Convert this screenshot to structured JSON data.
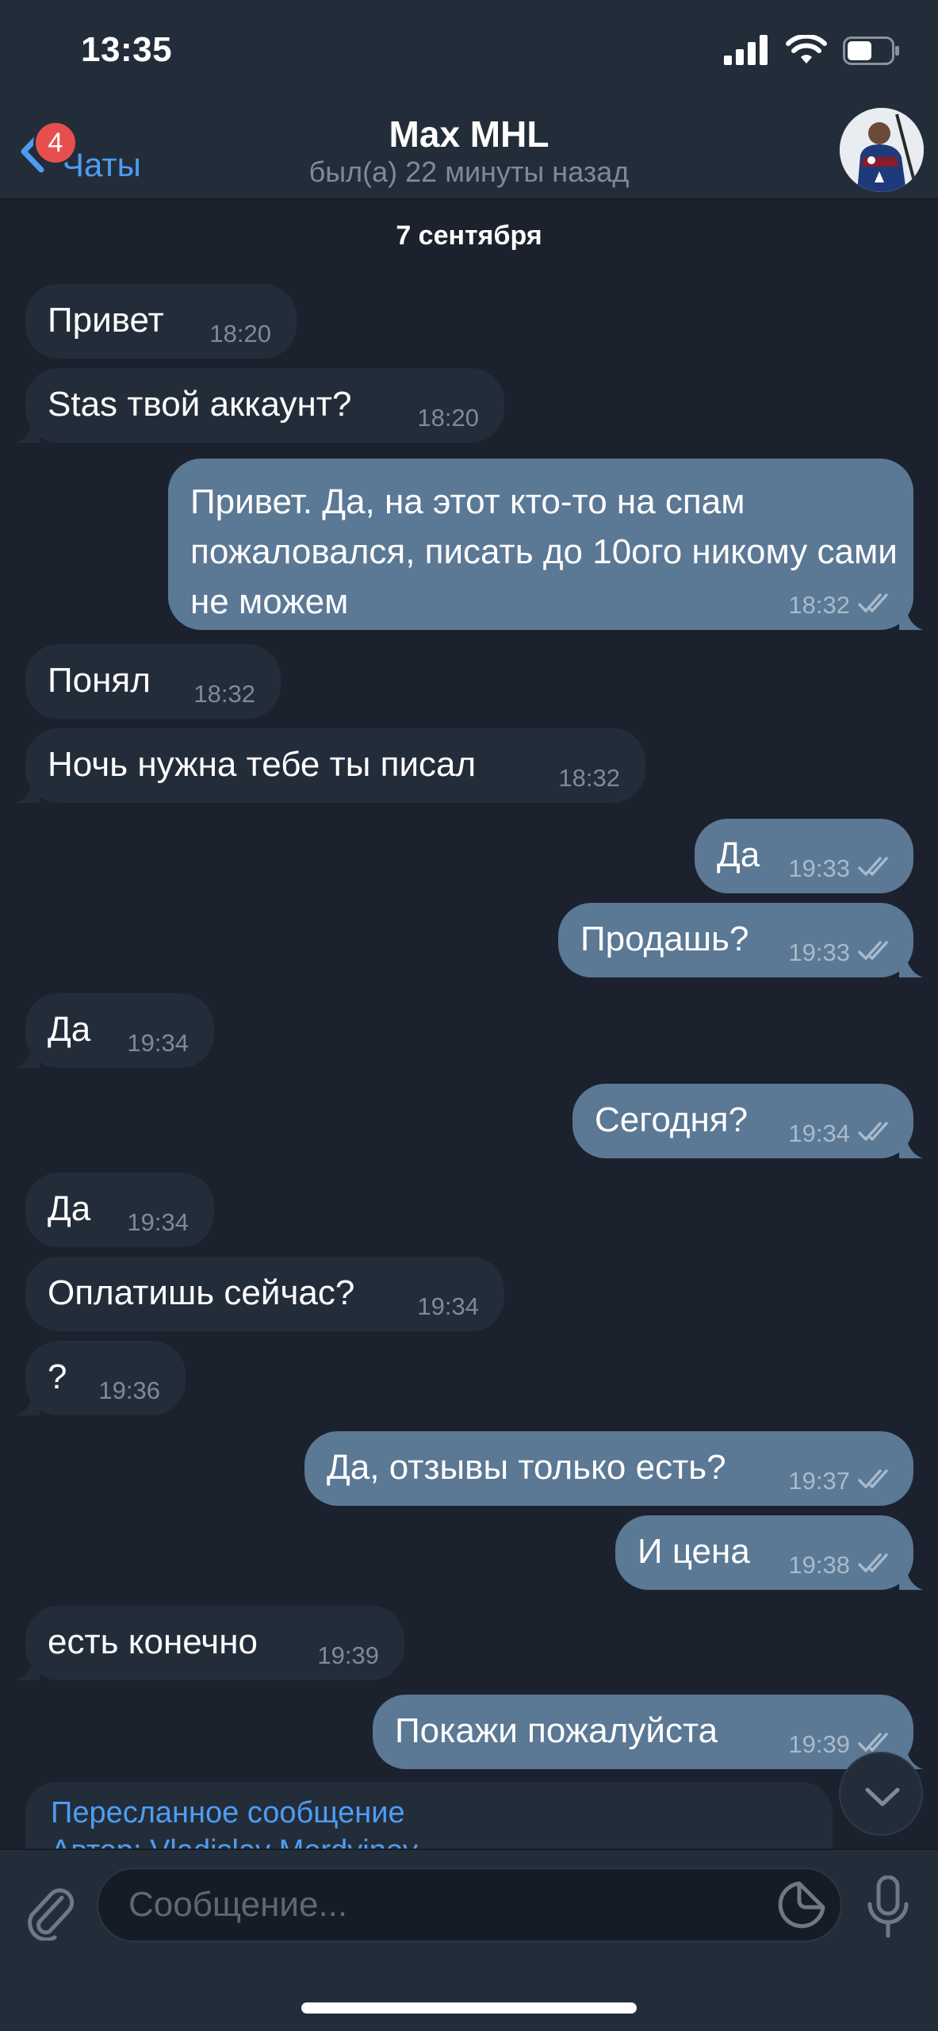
{
  "status_bar": {
    "time": "13:35"
  },
  "header": {
    "back_label": "Чаты",
    "unread_badge": "4",
    "title": "Max MHL",
    "status": "был(а) 22 минуты назад"
  },
  "date_separator": "7 сентября",
  "messages": [
    {
      "dir": "in",
      "text": "Привет",
      "time": "18:20"
    },
    {
      "dir": "in",
      "text": "Stas твой аккаунт?",
      "time": "18:20"
    },
    {
      "dir": "out",
      "text": "Привет. Да, на этот кто-то на спам пожаловался, писать до 10ого никому сами не можем",
      "time": "18:32"
    },
    {
      "dir": "in",
      "text": "Понял",
      "time": "18:32"
    },
    {
      "dir": "in",
      "text": "Ночь нужна тебе ты писал",
      "time": "18:32"
    },
    {
      "dir": "out",
      "text": "Да",
      "time": "19:33"
    },
    {
      "dir": "out",
      "text": "Продашь?",
      "time": "19:33"
    },
    {
      "dir": "in",
      "text": "Да",
      "time": "19:34"
    },
    {
      "dir": "out",
      "text": "Сегодня?",
      "time": "19:34"
    },
    {
      "dir": "in",
      "text": "Да",
      "time": "19:34"
    },
    {
      "dir": "in",
      "text": "Оплатишь сейчас?",
      "time": "19:34"
    },
    {
      "dir": "in",
      "text": "?",
      "time": "19:36"
    },
    {
      "dir": "out",
      "text": "Да, отзывы только есть?",
      "time": "19:37"
    },
    {
      "dir": "out",
      "text": "И цена",
      "time": "19:38"
    },
    {
      "dir": "in",
      "text": "есть конечно",
      "time": "19:39"
    },
    {
      "dir": "out",
      "text": "Покажи пожалуйста",
      "time": "19:39"
    }
  ],
  "forwarded": {
    "label": "Пересланное сообщение",
    "author_prefix": "Автор: ",
    "author_name": "Vladislav Mordvinov"
  },
  "input": {
    "placeholder": "Сообщение..."
  },
  "colors": {
    "background": "#1b222d",
    "incoming_bubble": "#232d3a",
    "outgoing_bubble": "#5b7895",
    "accent": "#4e9df3",
    "badge": "#e74f4f"
  }
}
